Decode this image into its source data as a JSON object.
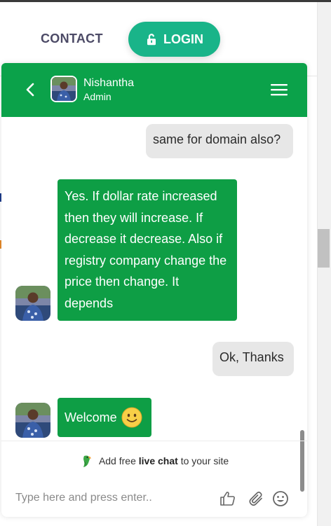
{
  "page": {
    "contact_label": "CONTACT",
    "login_label": "LOGIN"
  },
  "chat": {
    "agent_name": "Nishantha",
    "agent_role": "Admin",
    "messages": [
      {
        "from": "visitor",
        "text": "same for domain also?"
      },
      {
        "from": "agent",
        "text": "Yes. If dollar rate increased then they will increase. If decrease it decrease. Also if registry company change the price then change. It depends"
      },
      {
        "from": "visitor",
        "text": "Ok, Thanks"
      },
      {
        "from": "agent",
        "text": "Welcome",
        "emoji": "slightly-smiling-face"
      }
    ],
    "branding_prefix": "Add free",
    "branding_bold": "live chat",
    "branding_suffix": "to your site",
    "input_placeholder": "Type here and press enter..",
    "accent_color": "#0ba24a",
    "login_color": "#19b489"
  }
}
